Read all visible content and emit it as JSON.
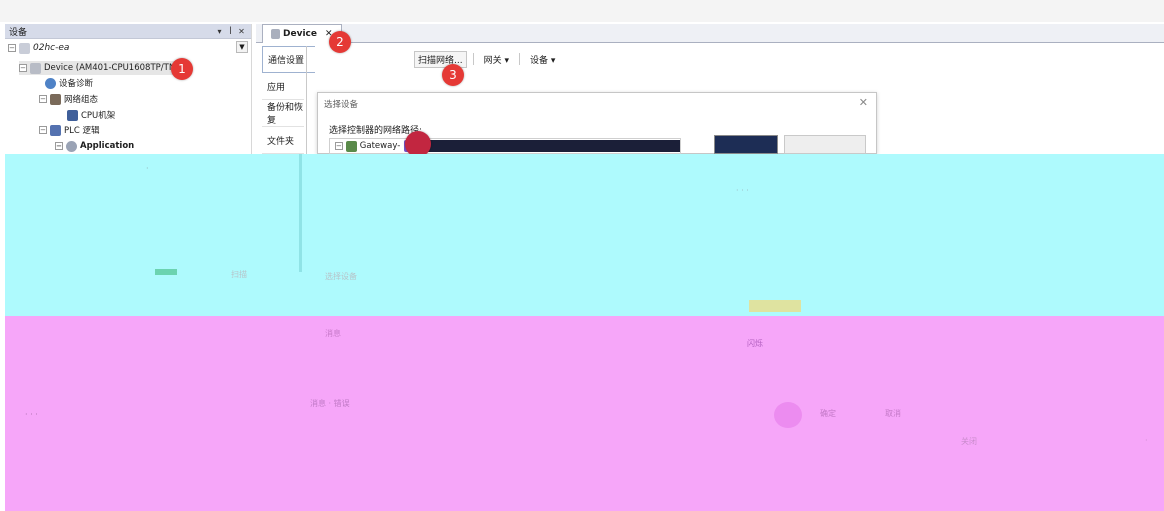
{
  "device_panel": {
    "title": "设备",
    "pin_glyph": "▾ ✦",
    "close_glyph": "✕",
    "tree": {
      "root": "02hc-ea",
      "device": "Device (AM401-CPU1608TP/TN)",
      "diagnostics": "设备诊断",
      "network_config": "网络组态",
      "cpu_rack": "CPU机架",
      "plc_logic": "PLC 逻辑",
      "application": "Application"
    }
  },
  "editor": {
    "tab_label": "Device",
    "tab_close": "✕",
    "nav": [
      "通信设置",
      "应用",
      "备份和恢复",
      "文件夹"
    ],
    "toolbar": {
      "scan": "扫描网络...",
      "gateway": "网关 ▾",
      "device": "设备 ▾"
    }
  },
  "dialog": {
    "title": "选择设备",
    "close": "✕",
    "label": "选择控制器的网络路径:",
    "gateway_node": "Gateway-"
  },
  "badges": [
    "1",
    "2",
    "3"
  ],
  "artifact_text": {
    "a1": "扫描",
    "a2": "消息",
    "a3": "消息 · 错误",
    "a4": "确定",
    "a5": "取消",
    "a6": "关闭",
    "a7": "选择设备",
    "a8": "闪烁"
  },
  "colors": {
    "cyan_artifact": "#aefafd",
    "pink_artifact": "#f6a6f9",
    "badge": "#e53935"
  }
}
